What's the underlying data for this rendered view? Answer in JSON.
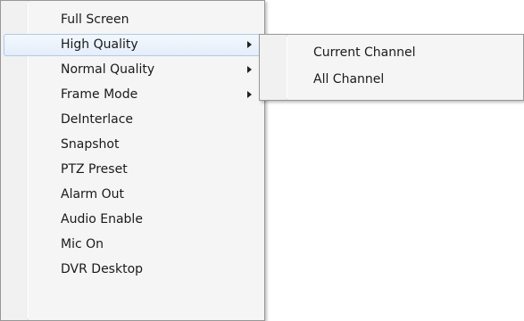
{
  "context_menu": {
    "items": [
      {
        "label": "Full Screen",
        "has_submenu": false
      },
      {
        "label": "High Quality",
        "has_submenu": true,
        "highlighted": true
      },
      {
        "label": "Normal Quality",
        "has_submenu": true
      },
      {
        "label": "Frame Mode",
        "has_submenu": true
      },
      {
        "label": "DeInterlace",
        "has_submenu": false
      },
      {
        "label": "Snapshot",
        "has_submenu": false
      },
      {
        "label": "PTZ Preset",
        "has_submenu": false
      },
      {
        "label": "Alarm Out",
        "has_submenu": false
      },
      {
        "label": "Audio Enable",
        "has_submenu": false
      },
      {
        "label": "Mic On",
        "has_submenu": false
      },
      {
        "label": "DVR Desktop",
        "has_submenu": false
      }
    ]
  },
  "submenu": {
    "parent": "High Quality",
    "items": [
      {
        "label": "Current Channel"
      },
      {
        "label": "All Channel"
      }
    ]
  },
  "colors": {
    "menu_background": "#f5f5f5",
    "menu_border": "#979797",
    "highlight_border": "#aecaf0",
    "highlight_fill": "#e4eef9",
    "text": "#1a1a1a"
  },
  "icons": {
    "submenu_arrow": "submenu-arrow-icon"
  }
}
